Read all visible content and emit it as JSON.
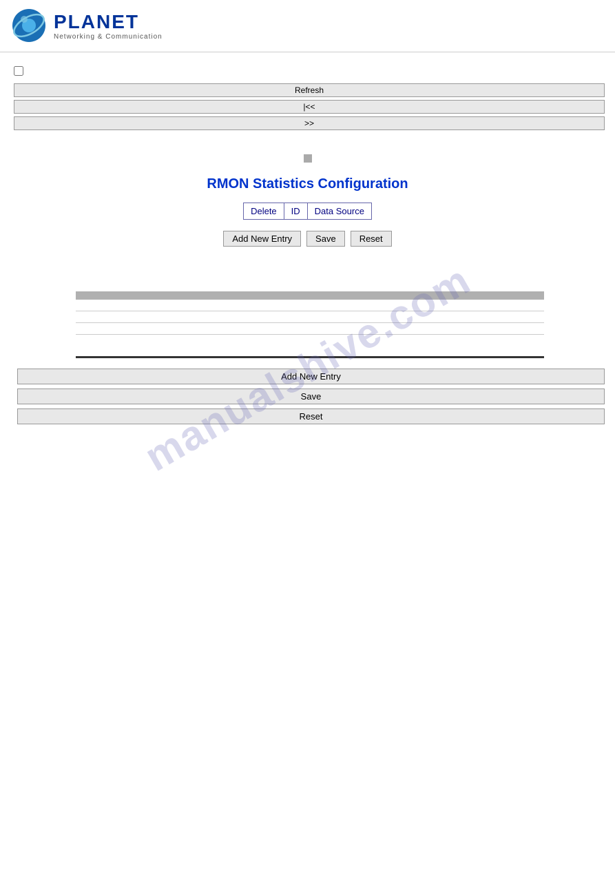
{
  "logo": {
    "planet_text": "PLANET",
    "subtitle": "Networking & Communication"
  },
  "top": {
    "refresh_label": "Refresh",
    "prev_label": "|<<",
    "next_label": ">>"
  },
  "page": {
    "title": "RMON Statistics Configuration",
    "scroll_indicator": ""
  },
  "table_header": {
    "delete_label": "Delete",
    "id_label": "ID",
    "data_source_label": "Data Source"
  },
  "toolbar": {
    "add_new_entry_label": "Add New Entry",
    "save_label": "Save",
    "reset_label": "Reset"
  },
  "data_table": {
    "columns": [
      "",
      ""
    ],
    "rows": [
      {
        "col1": "",
        "col2": ""
      },
      {
        "col1": "",
        "col2": ""
      },
      {
        "col1": "",
        "col2": ""
      },
      {
        "col1": "",
        "col2": ""
      }
    ]
  },
  "bottom_buttons": {
    "add_new_entry_label": "Add New Entry",
    "save_label": "Save",
    "reset_label": "Reset"
  },
  "watermark": "manualshive.com"
}
